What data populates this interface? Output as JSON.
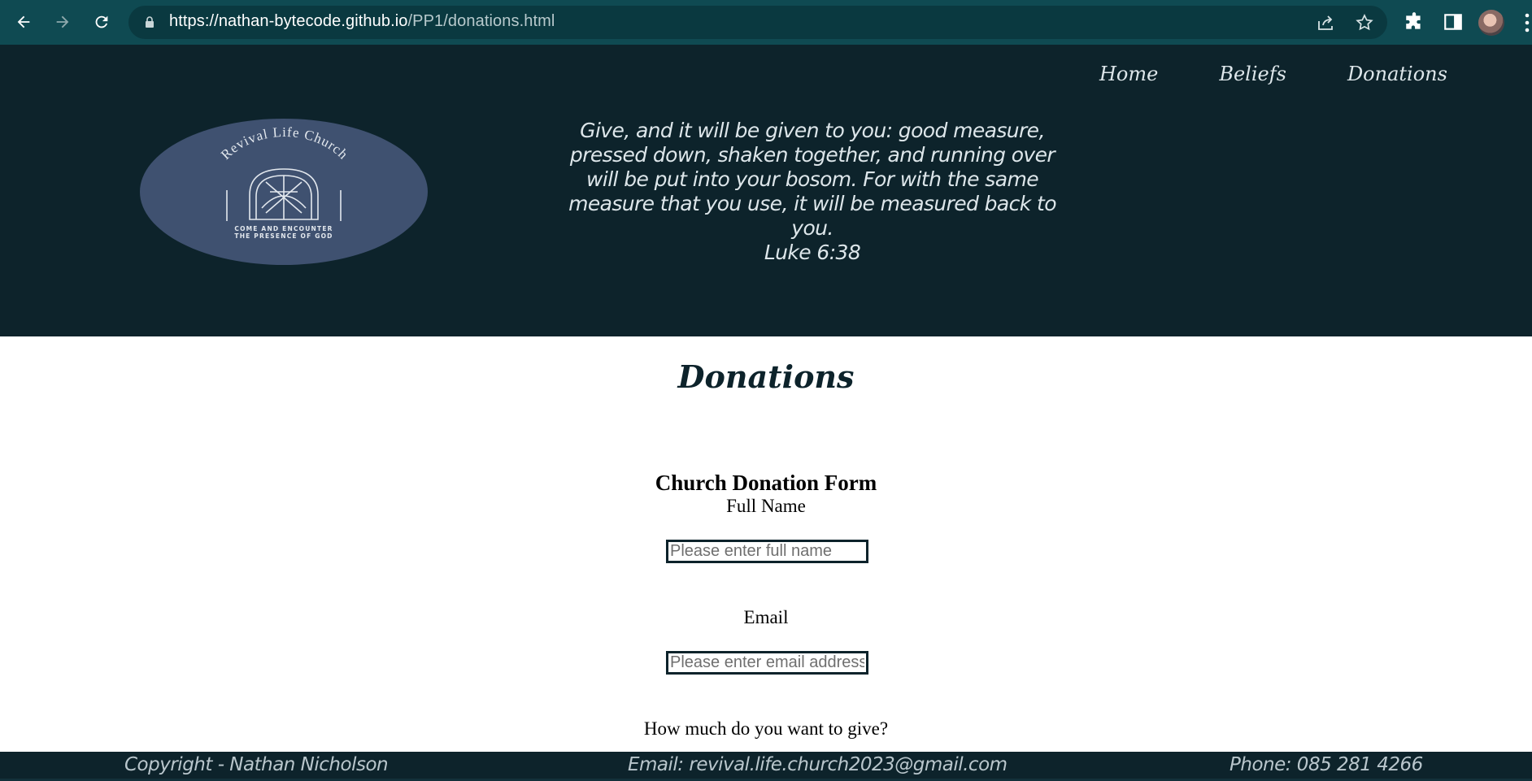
{
  "browser": {
    "url_host": "https://nathan-bytecode.github.io",
    "url_path": "/PP1/donations.html",
    "icons": [
      "back-icon",
      "forward-icon",
      "reload-icon",
      "lock-icon",
      "share-icon",
      "star-icon",
      "extensions-icon",
      "side-panel-icon",
      "profile-avatar",
      "menu-icon"
    ]
  },
  "nav": {
    "items": [
      {
        "label": "Home"
      },
      {
        "label": "Beliefs"
      },
      {
        "label": "Donations"
      }
    ]
  },
  "logo": {
    "name": "Revival Life Church",
    "tagline_line1": "COME AND ENCOUNTER",
    "tagline_line2": "THE PRESENCE OF GOD"
  },
  "verse": {
    "text": "Give, and it will be given to you: good measure, pressed down, shaken together, and running over will be put into your bosom. For with the same measure that you use, it will be measured back to you.",
    "reference": "Luke 6:38"
  },
  "page": {
    "title": "Donations"
  },
  "form": {
    "title": "Church Donation Form",
    "name_label": "Full Name",
    "name_placeholder": "Please enter full name",
    "name_value": "",
    "email_label": "Email",
    "email_placeholder": "Please enter email address",
    "email_value": "",
    "amount_label": "How much do you want to give?"
  },
  "footer": {
    "copyright": "Copyright - Nathan Nicholson",
    "email": "Email: revival.life.church2023@gmail.com",
    "phone": "Phone: 085 281 4266"
  },
  "colors": {
    "chrome": "#0f4a52",
    "header_bg": "#0d232b",
    "logo_bg": "#3f5170",
    "light_text": "#dde6ea"
  }
}
